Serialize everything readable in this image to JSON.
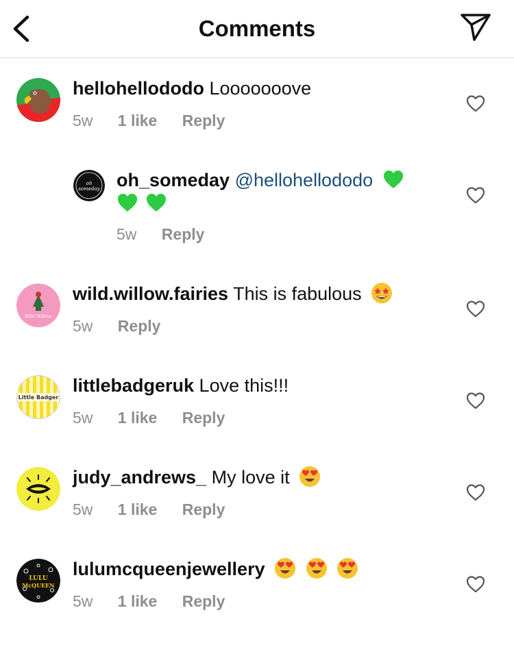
{
  "header": {
    "title": "Comments"
  },
  "comments": [
    {
      "username": "hellohellododo",
      "text": "Looooooove",
      "time": "5w",
      "likes": "1 like",
      "reply": "Reply"
    },
    {
      "username": "oh_someday",
      "mention": "@hellohellododo",
      "time": "5w",
      "reply": "Reply",
      "avatar_text": "oh someday"
    },
    {
      "username": "wild.willow.fairies",
      "text": "This is fabulous",
      "time": "5w",
      "reply": "Reply",
      "avatar_text": "Wild Willow"
    },
    {
      "username": "littlebadgeruk",
      "text": "Love this!!!",
      "time": "5w",
      "likes": "1 like",
      "reply": "Reply",
      "avatar_text": "Little Badger"
    },
    {
      "username": "judy_andrews_",
      "text": "My love it",
      "time": "5w",
      "likes": "1 like",
      "reply": "Reply"
    },
    {
      "username": "lulumcqueenjewellery",
      "time": "5w",
      "likes": "1 like",
      "reply": "Reply",
      "avatar_text": "LULU McQUEEN"
    }
  ],
  "colors": {
    "mention": "#1b4f7a",
    "meta": "#8e8e8e",
    "green_heart": "#2ecc40",
    "divider": "#dbdbdb"
  },
  "icons": [
    "chevron-left-icon",
    "send-icon",
    "heart-outline-icon",
    "green-heart-emoji",
    "star-struck-emoji",
    "heart-eyes-emoji"
  ]
}
